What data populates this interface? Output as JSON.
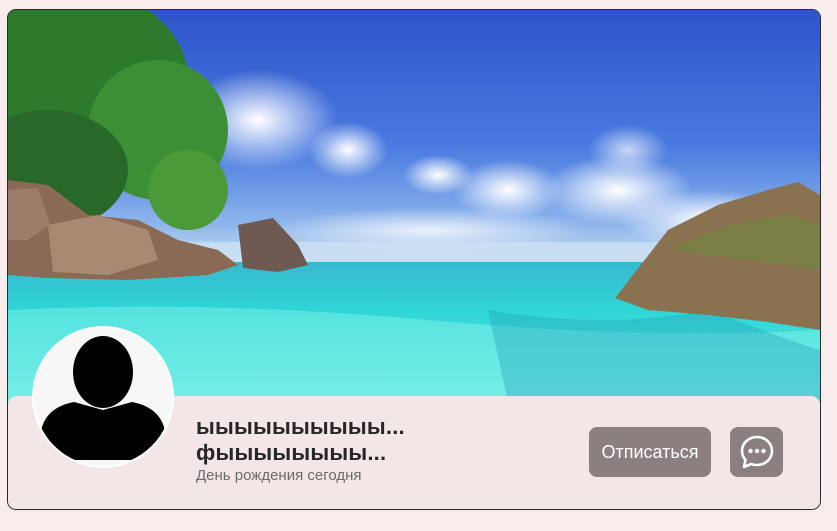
{
  "profile": {
    "name_line_1": "ыыыыыыыыыы...",
    "name_line_2": "фыыыыыыыы...",
    "birthday_text": "День рождения сегодня",
    "avatar_icon": "default-user-silhouette"
  },
  "actions": {
    "unsubscribe_label": "Отписаться",
    "message_icon": "chat-bubble-icon"
  },
  "colors": {
    "page_bg": "#f8ecec",
    "panel_bg": "#f3e6e6",
    "button_bg": "#8c7f7f",
    "button_text": "#ffffff"
  }
}
